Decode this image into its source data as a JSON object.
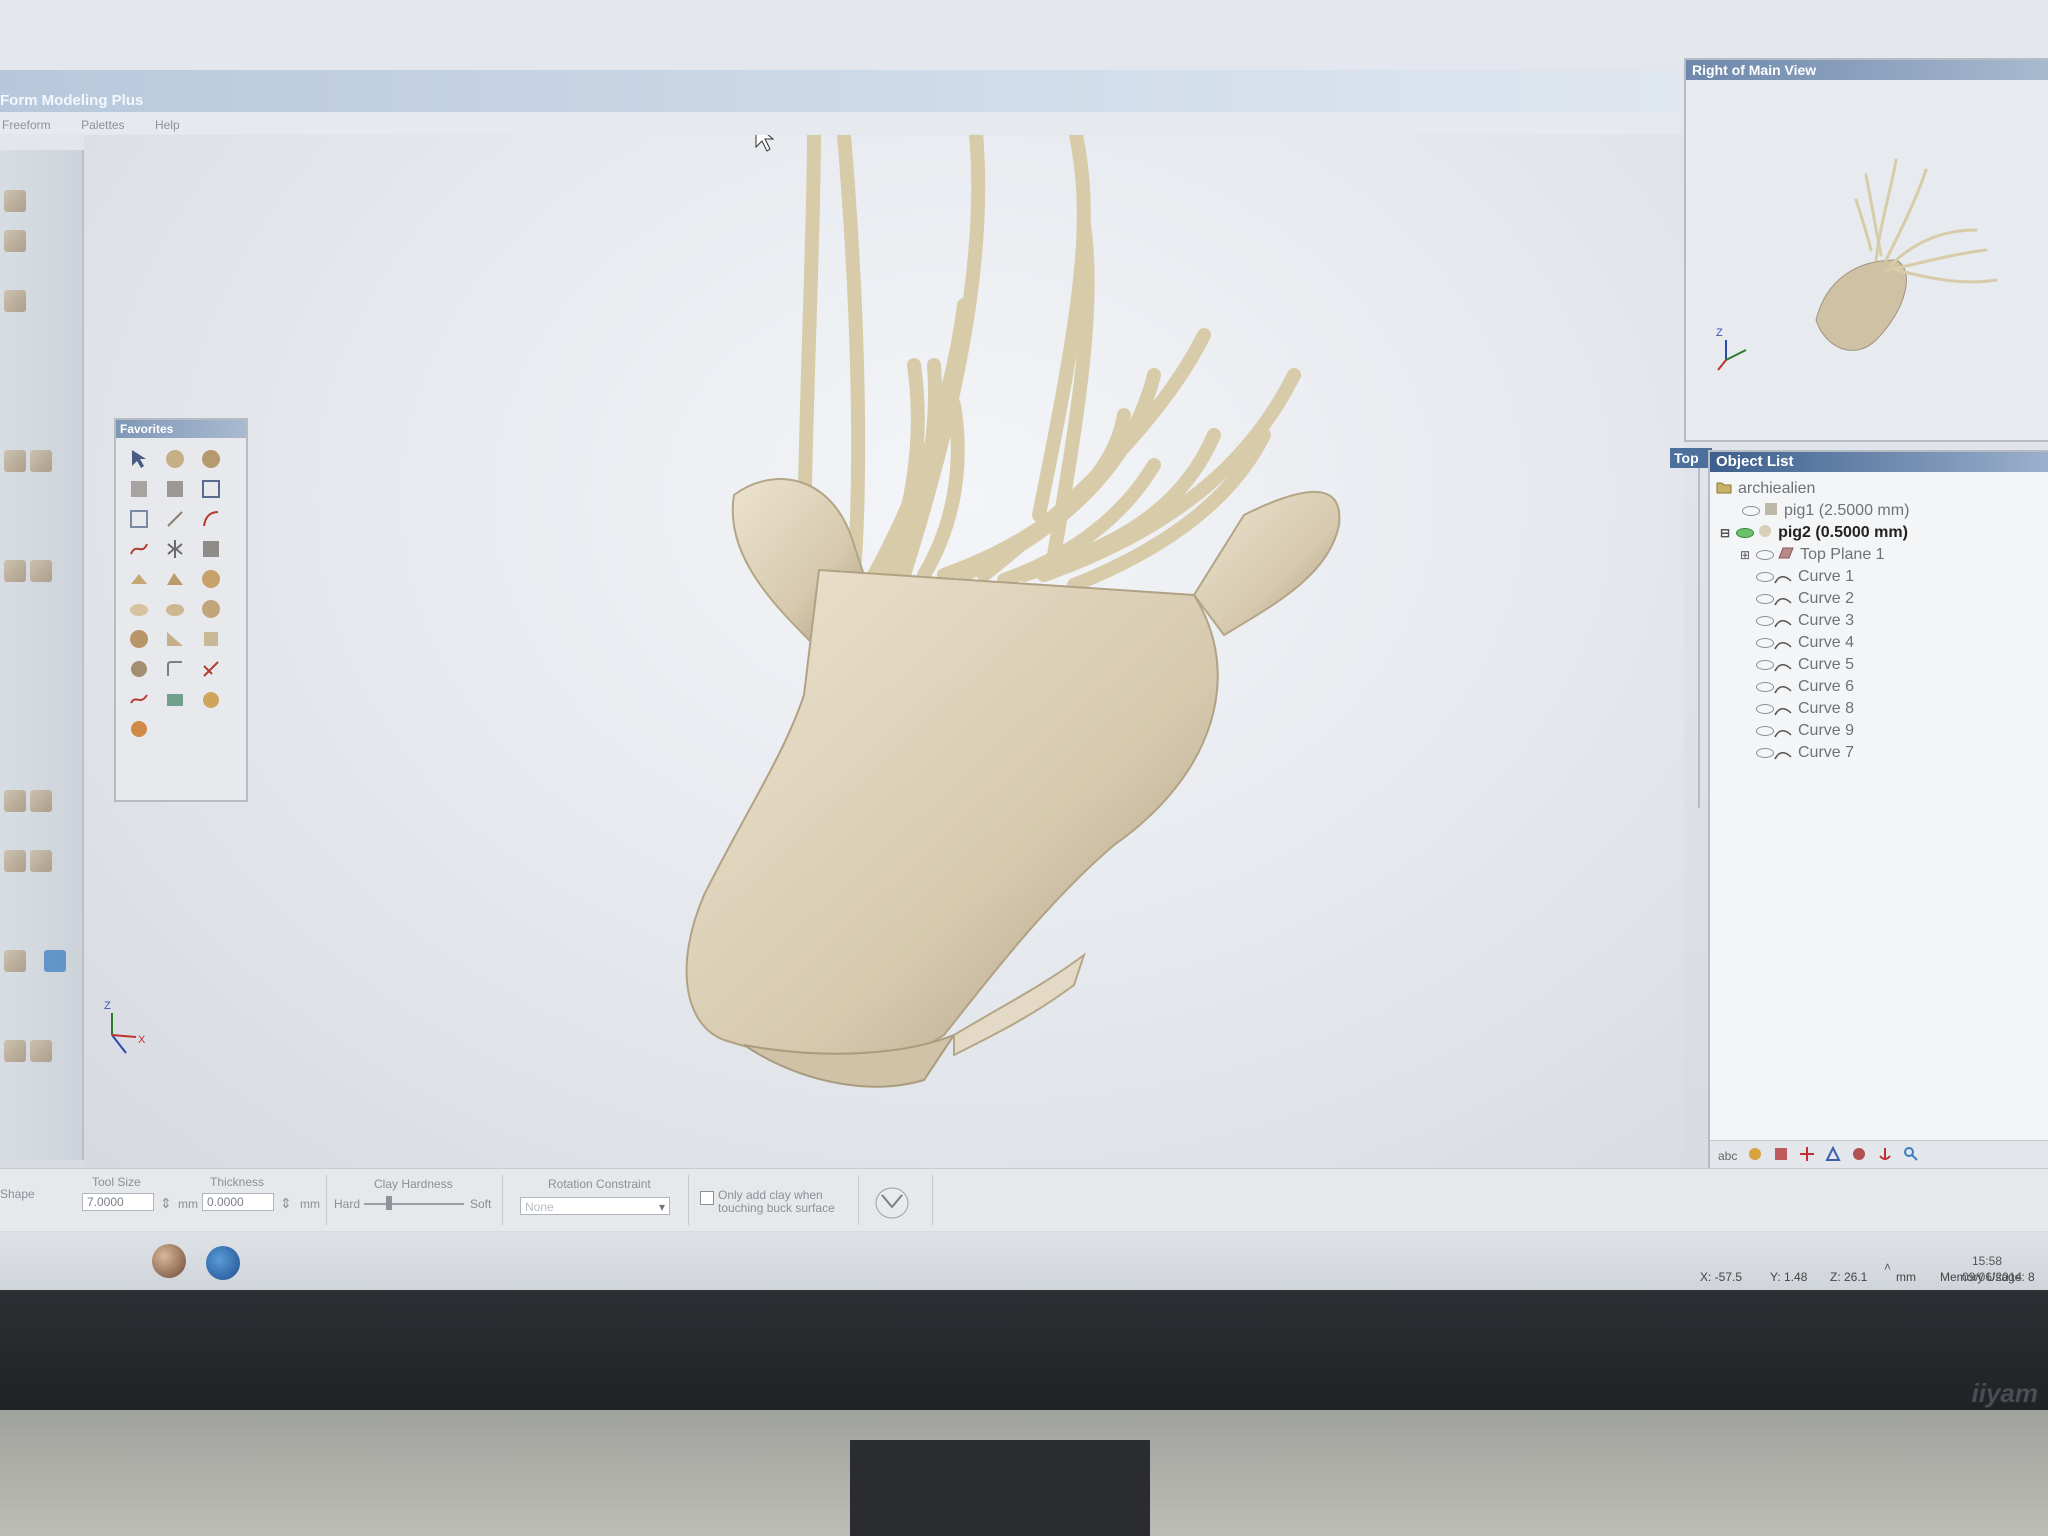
{
  "app": {
    "title": "Form Modeling Plus"
  },
  "menu": [
    "Freeform",
    "Palettes",
    "Help"
  ],
  "favorites": {
    "title": "Favorites"
  },
  "right_view": {
    "title": "Right of Main View"
  },
  "top_tab": "Top",
  "object_list": {
    "title": "Object List",
    "items": [
      {
        "label": "archiealien",
        "level": 0
      },
      {
        "label": "pig1 (2.5000 mm)",
        "level": 1
      },
      {
        "label": "pig2 (0.5000 mm)",
        "level": 1,
        "selected": true
      },
      {
        "label": "Top Plane 1",
        "level": 2
      },
      {
        "label": "Curve 1",
        "level": 2
      },
      {
        "label": "Curve 2",
        "level": 2
      },
      {
        "label": "Curve 3",
        "level": 2
      },
      {
        "label": "Curve 4",
        "level": 2
      },
      {
        "label": "Curve 5",
        "level": 2
      },
      {
        "label": "Curve 6",
        "level": 2
      },
      {
        "label": "Curve 8",
        "level": 2
      },
      {
        "label": "Curve 9",
        "level": 2
      },
      {
        "label": "Curve 7",
        "level": 2
      }
    ],
    "footer": "abc"
  },
  "options": {
    "shape_label": "Shape",
    "tool_size_label": "Tool Size",
    "tool_size_value": "7.0000",
    "thickness_label": "Thickness",
    "thickness_value": "0.0000",
    "unit": "mm",
    "clay_hardness_label": "Clay Hardness",
    "hard_label": "Hard",
    "soft_label": "Soft",
    "rotation_label": "Rotation Constraint",
    "rotation_value": "None",
    "only_add_clay": "Only add clay when touching buck surface"
  },
  "status": {
    "x": "X: -57.5",
    "y": "Y: 1.48",
    "z": "Z: 26.1",
    "unit": "mm",
    "memory": "Memory Usage: 8",
    "time": "15:58",
    "date": "09/06/2014"
  },
  "axes": {
    "z": "Z",
    "x": "X"
  },
  "monitor_brand": "iiyam",
  "colors": {
    "model": "#d9cdb5",
    "model_shadow": "#a3957b",
    "title_blue": "#3d5f8d"
  }
}
